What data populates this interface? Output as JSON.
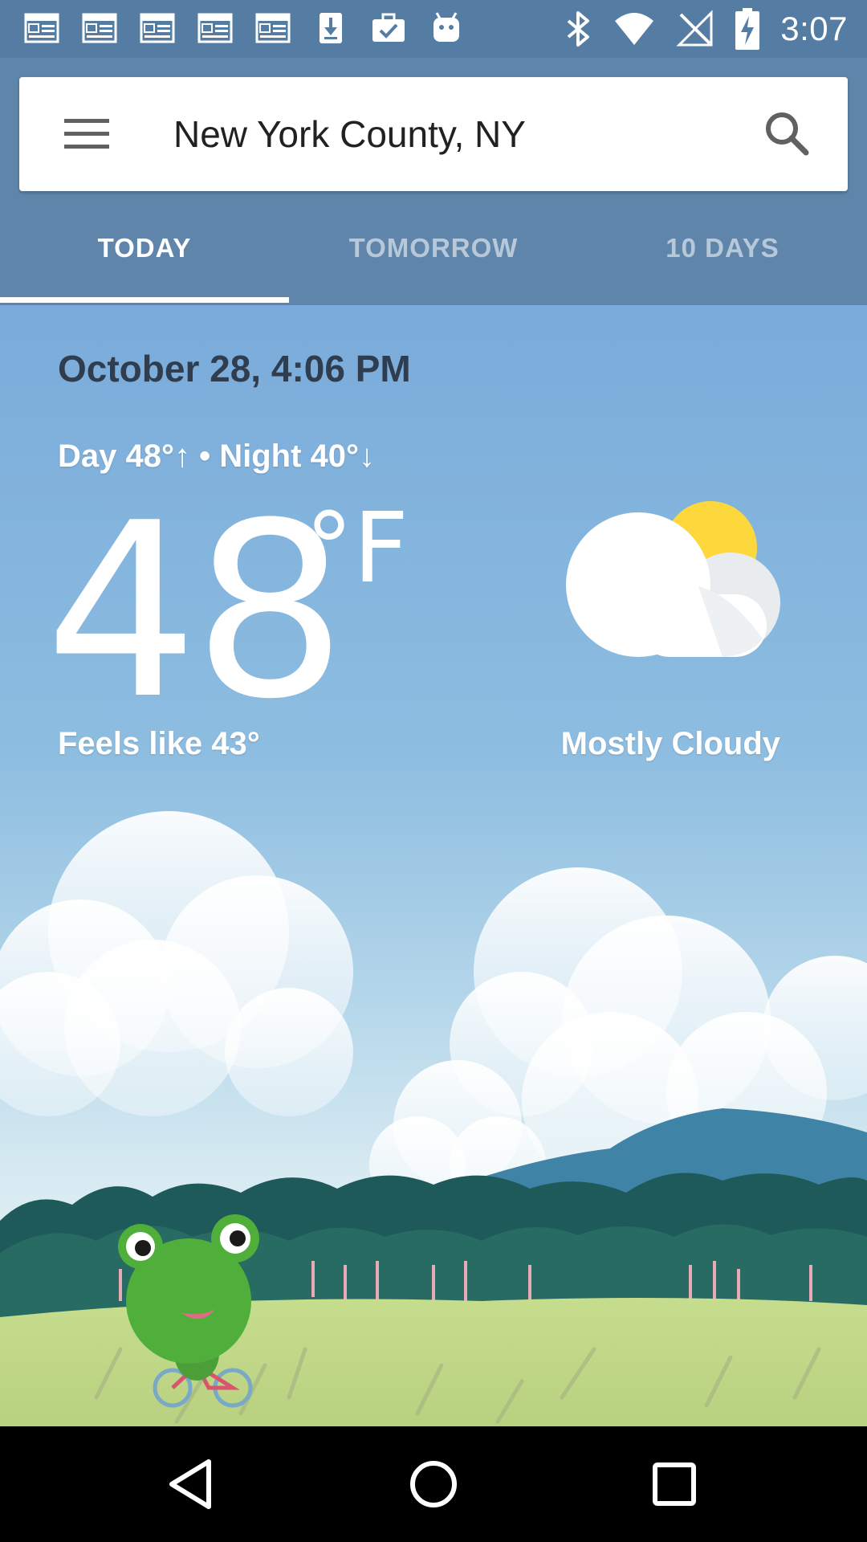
{
  "status_bar": {
    "time": "3:07",
    "left_icons": [
      "news-icon",
      "news-icon",
      "news-icon",
      "news-icon",
      "news-icon",
      "download-icon",
      "briefcase-check-icon",
      "android-icon"
    ],
    "right_icons": [
      "bluetooth-icon",
      "wifi-icon",
      "signal-off-icon",
      "battery-charging-icon"
    ]
  },
  "search_bar": {
    "location": "New York County, NY",
    "menu_icon": "hamburger-menu-icon",
    "search_icon": "search-icon"
  },
  "tabs": [
    {
      "label": "TODAY",
      "active": true
    },
    {
      "label": "TOMORROW",
      "active": false
    },
    {
      "label": "10 DAYS",
      "active": false
    }
  ],
  "weather": {
    "datetime": "October 28, 4:06 PM",
    "day_night": "Day 48°↑ • Night 40°↓",
    "temperature": "48",
    "unit": "°F",
    "feels_like": "Feels like 43°",
    "condition": "Mostly Cloudy",
    "condition_icon": "partly-cloudy-icon"
  },
  "nav_bar": {
    "back_icon": "back-icon",
    "home_icon": "home-icon",
    "recents_icon": "recents-icon"
  },
  "colors": {
    "header": "#5f86aa",
    "status_bar": "#557da4",
    "sky_top": "#7aabda",
    "sun": "#fdd83c"
  }
}
